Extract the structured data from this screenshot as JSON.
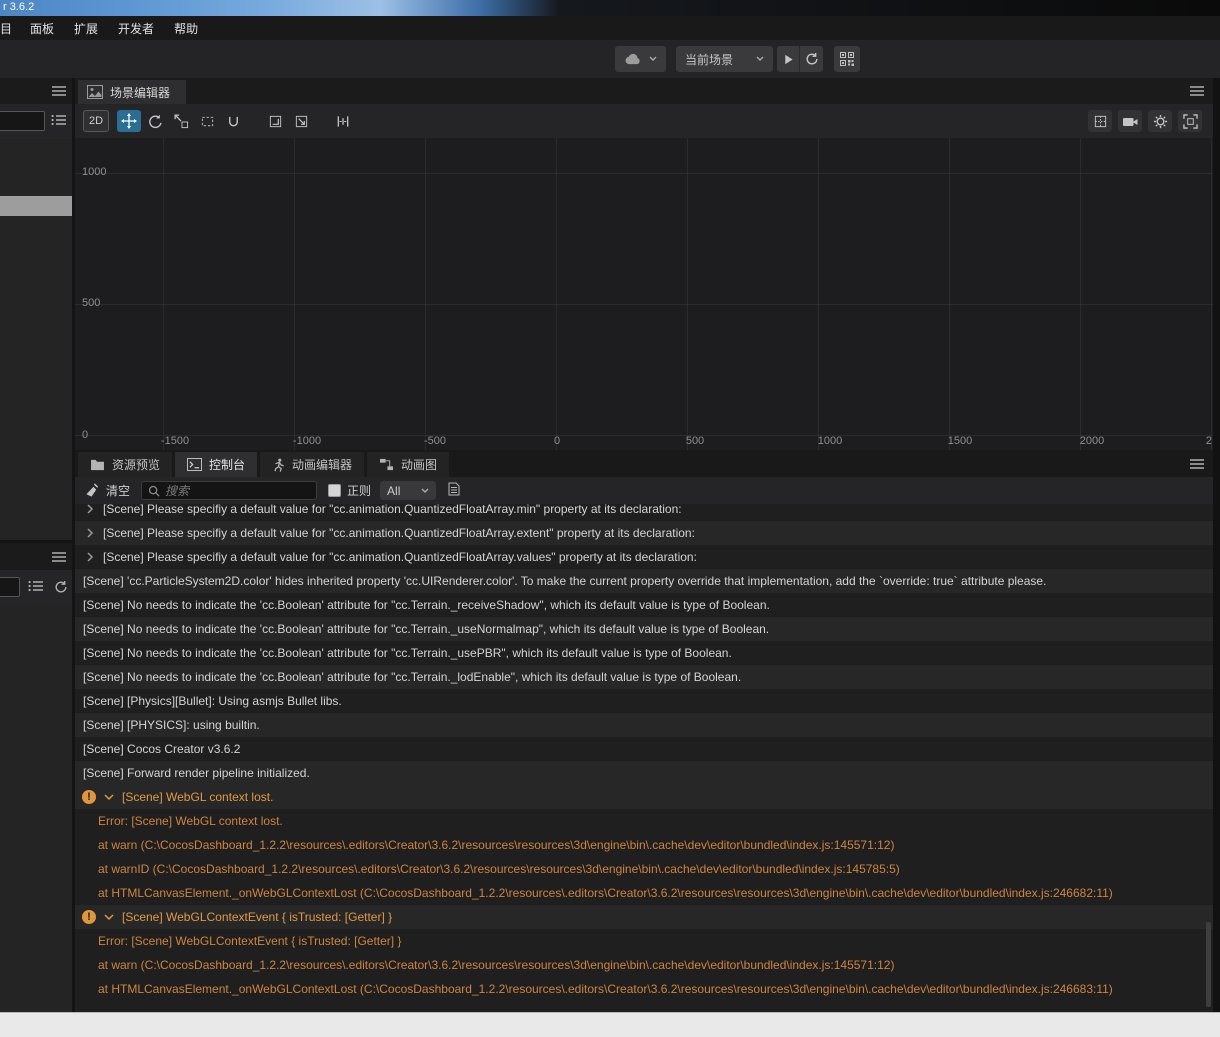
{
  "window": {
    "title": "r 3.6.2"
  },
  "menu": {
    "items": [
      "目",
      "面板",
      "扩展",
      "开发者",
      "帮助"
    ]
  },
  "top_toolbar": {
    "scene_select_value": "当前场景"
  },
  "scene_editor": {
    "tab_label": "场景编辑器",
    "mode_2d_label": "2D",
    "ruler": {
      "vertical": [
        "1000",
        "500",
        "0"
      ],
      "horizontal": [
        "-1500",
        "-1000",
        "-500",
        "0",
        "500",
        "1000",
        "1500",
        "2000"
      ],
      "right_edge_partial": "2"
    }
  },
  "bottom_panel": {
    "tabs": [
      {
        "label": "资源预览",
        "active": false
      },
      {
        "label": "控制台",
        "active": true
      },
      {
        "label": "动画编辑器",
        "active": false
      },
      {
        "label": "动画图",
        "active": false
      }
    ],
    "console": {
      "clear_label": "清空",
      "search_placeholder": "搜索",
      "regex_label": "正则",
      "filter_value": "All",
      "logs": [
        {
          "type": "collapsed",
          "text": "[Scene] Please specifiy a default value for \"cc.animation.QuantizedFloatArray.min\" property at its declaration:"
        },
        {
          "type": "collapsed",
          "text": "[Scene] Please specifiy a default value for \"cc.animation.QuantizedFloatArray.extent\" property at its declaration:"
        },
        {
          "type": "collapsed",
          "text": "[Scene] Please specifiy a default value for \"cc.animation.QuantizedFloatArray.values\" property at its declaration:"
        },
        {
          "type": "info",
          "text": "[Scene] 'cc.ParticleSystem2D.color' hides inherited property 'cc.UIRenderer.color'. To make the current property override that implementation, add the `override: true` attribute please."
        },
        {
          "type": "info",
          "text": "[Scene] No needs to indicate the 'cc.Boolean' attribute for \"cc.Terrain._receiveShadow\", which its default value is type of Boolean."
        },
        {
          "type": "info",
          "text": "[Scene] No needs to indicate the 'cc.Boolean' attribute for \"cc.Terrain._useNormalmap\", which its default value is type of Boolean."
        },
        {
          "type": "info",
          "text": "[Scene] No needs to indicate the 'cc.Boolean' attribute for \"cc.Terrain._usePBR\", which its default value is type of Boolean."
        },
        {
          "type": "info",
          "text": "[Scene] No needs to indicate the 'cc.Boolean' attribute for \"cc.Terrain._lodEnable\", which its default value is type of Boolean."
        },
        {
          "type": "info",
          "text": "[Scene] [Physics][Bullet]: Using asmjs Bullet libs."
        },
        {
          "type": "info",
          "text": "[Scene] [PHYSICS]: using builtin."
        },
        {
          "type": "info",
          "text": "[Scene] Cocos Creator v3.6.2"
        },
        {
          "type": "info",
          "text": "[Scene] Forward render pipeline initialized."
        },
        {
          "type": "warn",
          "text": "[Scene] WebGL context lost."
        },
        {
          "type": "trace",
          "text": "Error: [Scene] WebGL context lost."
        },
        {
          "type": "trace",
          "text": "at warn (C:\\CocosDashboard_1.2.2\\resources\\.editors\\Creator\\3.6.2\\resources\\resources\\3d\\engine\\bin\\.cache\\dev\\editor\\bundled\\index.js:145571:12)"
        },
        {
          "type": "trace",
          "text": "at warnID (C:\\CocosDashboard_1.2.2\\resources\\.editors\\Creator\\3.6.2\\resources\\resources\\3d\\engine\\bin\\.cache\\dev\\editor\\bundled\\index.js:145785:5)"
        },
        {
          "type": "trace",
          "text": "at HTMLCanvasElement._onWebGLContextLost (C:\\CocosDashboard_1.2.2\\resources\\.editors\\Creator\\3.6.2\\resources\\resources\\3d\\engine\\bin\\.cache\\dev\\editor\\bundled\\index.js:246682:11)"
        },
        {
          "type": "warn",
          "text": "[Scene] WebGLContextEvent { isTrusted: [Getter] }"
        },
        {
          "type": "trace",
          "text": "Error: [Scene] WebGLContextEvent { isTrusted: [Getter] }"
        },
        {
          "type": "trace",
          "text": "at warn (C:\\CocosDashboard_1.2.2\\resources\\.editors\\Creator\\3.6.2\\resources\\resources\\3d\\engine\\bin\\.cache\\dev\\editor\\bundled\\index.js:145571:12)"
        },
        {
          "type": "trace",
          "text": "at HTMLCanvasElement._onWebGLContextLost (C:\\CocosDashboard_1.2.2\\resources\\.editors\\Creator\\3.6.2\\resources\\resources\\3d\\engine\\bin\\.cache\\dev\\editor\\bundled\\index.js:246683:11)"
        }
      ]
    }
  },
  "colors": {
    "warning_text": "#e09a45",
    "trace_text": "#cf8440",
    "active_tool_blue": "#2a6e93",
    "selection_gray": "#9d9d9d",
    "panel_dark": "#1f1f1f",
    "toolbar_dark": "#252527"
  },
  "icons": {
    "hamburger-icon": "three horizontal lines",
    "list-icon": "bulleted list lines",
    "refresh-icon": "circular arrow",
    "play-icon": "triangle",
    "qr-code-icon": "qr squares",
    "device-cloud-icon": "cloud",
    "chevron-down-icon": "v",
    "chevron-right-icon": "›",
    "image-icon": "picture with mountain",
    "move-tool-icon": "four-direction arrows",
    "rotate-tool-icon": "circular arrow",
    "scale-tool-icon": "square with diagonal arrow",
    "rect-tool-icon": "dashed rectangle",
    "gizmo-u-icon": "U shape",
    "snap-icon": "square with corner path",
    "align-icon": "vertical bars",
    "grid-icon": "square with dashed cross",
    "camera-icon": "video camera",
    "gear-icon": "cog",
    "frame-icon": "corner brackets",
    "folder-icon": "folder",
    "terminal-icon": "prompt in box",
    "runner-icon": "running figure",
    "graph-icon": "connected nodes",
    "broom-icon": "broom",
    "search-icon": "magnifier",
    "document-icon": "page with lines",
    "warning-icon": "orange circle with !"
  }
}
